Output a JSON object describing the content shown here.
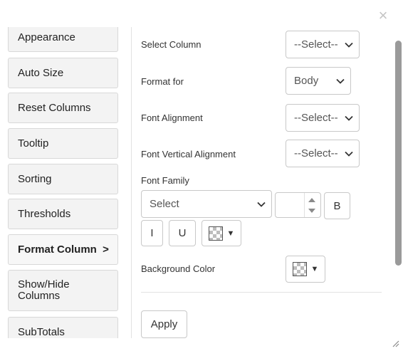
{
  "dialog": {
    "close_label": "×"
  },
  "sidebar": {
    "items": [
      {
        "label": "Appearance"
      },
      {
        "label": "Auto Size"
      },
      {
        "label": "Reset Columns"
      },
      {
        "label": "Tooltip"
      },
      {
        "label": "Sorting"
      },
      {
        "label": "Thresholds"
      },
      {
        "label": "Format Column  >",
        "active": true
      },
      {
        "label": "Show/Hide Columns"
      },
      {
        "label": "SubTotals"
      }
    ]
  },
  "form": {
    "select_column": {
      "label": "Select Column",
      "value": "--Select--"
    },
    "format_for": {
      "label": "Format for",
      "value": "Body"
    },
    "font_alignment": {
      "label": "Font Alignment",
      "value": "--Select--"
    },
    "font_vertical_alignment": {
      "label": "Font Vertical Alignment",
      "value": "--Select--"
    },
    "font_family": {
      "label": "Font Family",
      "value": "Select"
    },
    "font_size": {
      "value": ""
    },
    "bold_label": "B",
    "italic_label": "I",
    "underline_label": "U",
    "background_color": {
      "label": "Background Color"
    },
    "apply_label": "Apply"
  }
}
